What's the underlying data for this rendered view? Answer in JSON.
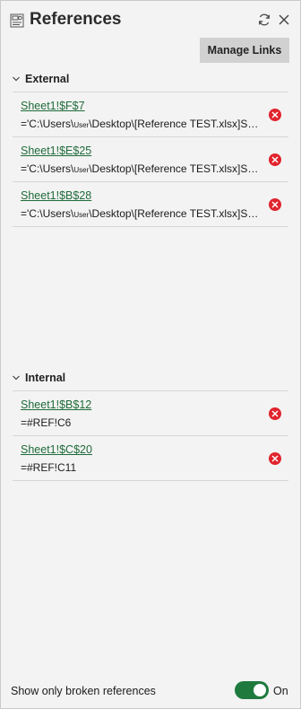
{
  "pane": {
    "title": "References",
    "icons": {
      "app": "references-icon",
      "refresh": "refresh-icon",
      "close": "close-icon"
    }
  },
  "toolbar": {
    "manage_links_label": "Manage Links"
  },
  "external": {
    "heading": "External",
    "items": [
      {
        "link": "Sheet1!$F$7",
        "formula_pre": "='C:\\Users\\",
        "formula_user": "User",
        "formula_post": "\\Desktop\\[Reference TEST.xlsx]She..."
      },
      {
        "link": "Sheet1!$E$25",
        "formula_pre": "='C:\\Users\\",
        "formula_user": "User",
        "formula_post": "\\Desktop\\[Reference TEST.xlsx]She..."
      },
      {
        "link": "Sheet1!$B$28",
        "formula_pre": "='C:\\Users\\",
        "formula_user": "User",
        "formula_post": "\\Desktop\\[Reference TEST.xlsx]She..."
      }
    ]
  },
  "internal": {
    "heading": "Internal",
    "items": [
      {
        "link": "Sheet1!$B$12",
        "formula": "=#REF!C6"
      },
      {
        "link": "Sheet1!$C$20",
        "formula": "=#REF!C11"
      }
    ]
  },
  "footer": {
    "toggle_label": "Show only broken references",
    "toggle_state": "On"
  },
  "colors": {
    "accent": "#1f7a3d",
    "link": "#1f6b3a",
    "delete": "#e0242d",
    "button": "#d1d1d1"
  }
}
